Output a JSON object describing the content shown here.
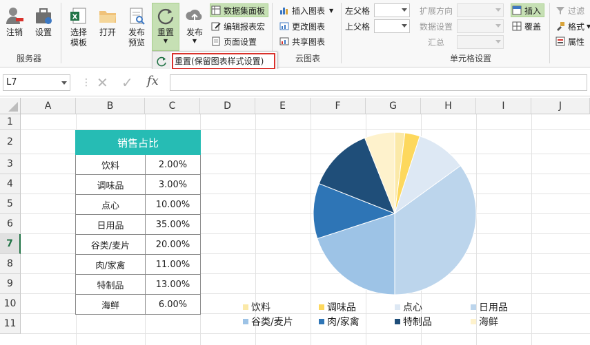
{
  "ribbon": {
    "buttons": [
      {
        "key": "logout",
        "label": "注销"
      },
      {
        "key": "settings",
        "label": "设置"
      },
      {
        "key": "select_template",
        "label": "选择\n模板"
      },
      {
        "key": "open",
        "label": "打开"
      },
      {
        "key": "publish_preview",
        "label": "发布\n预览"
      },
      {
        "key": "reset",
        "label": "重置"
      },
      {
        "key": "publish",
        "label": "发布"
      }
    ],
    "small_buttons": {
      "dataset_panel": "数据集面板",
      "edit_report_macro": "编辑报表宏",
      "page_settings": "页面设置",
      "insert_chart": "插入图表",
      "change_chart": "更改图表",
      "share_chart": "共享图表",
      "left_parent": "左父格",
      "top_parent": "上父格",
      "expand_direction": "扩展方向",
      "data_settings": "数据设置",
      "summary": "汇总",
      "insert": "插入",
      "overwrite": "覆盖",
      "filter": "过滤",
      "format": "格式",
      "properties": "属性"
    },
    "group_labels": {
      "server": "服务器",
      "cloud_chart": "云图表",
      "cell_settings": "单元格设置"
    }
  },
  "popup": {
    "item_label": "重置(保留图表样式设置)"
  },
  "formula_bar": {
    "name_box": "L7",
    "fx": "fx"
  },
  "columns": [
    "A",
    "B",
    "C",
    "D",
    "E",
    "F",
    "G",
    "H",
    "I",
    "J"
  ],
  "rows": [
    "1",
    "2",
    "3",
    "4",
    "5",
    "6",
    "7",
    "8",
    "9",
    "10",
    "11"
  ],
  "active_row": "7",
  "table": {
    "header": "销售占比",
    "rows": [
      {
        "name": "饮料",
        "value": "2.00%"
      },
      {
        "name": "调味品",
        "value": "3.00%"
      },
      {
        "name": "点心",
        "value": "10.00%"
      },
      {
        "name": "日用品",
        "value": "35.00%"
      },
      {
        "name": "谷类/麦片",
        "value": "20.00%"
      },
      {
        "name": "肉/家禽",
        "value": "11.00%"
      },
      {
        "name": "特制品",
        "value": "13.00%"
      },
      {
        "name": "海鲜",
        "value": "6.00%"
      }
    ]
  },
  "chart_data": {
    "type": "pie",
    "title": "",
    "categories": [
      "饮料",
      "调味品",
      "点心",
      "日用品",
      "谷类/麦片",
      "肉/家禽",
      "特制品",
      "海鲜"
    ],
    "values": [
      2,
      3,
      10,
      35,
      20,
      11,
      13,
      6
    ],
    "colors": [
      "#fbe9a8",
      "#fdd85d",
      "#dde8f4",
      "#bcd5ec",
      "#9dc3e6",
      "#2e75b6",
      "#1f4e79",
      "#fef2cc"
    ],
    "legend_position": "bottom"
  },
  "colors": {
    "accent": "#217346",
    "table_header": "#26bcb4",
    "highlight_border": "#d9312b"
  }
}
